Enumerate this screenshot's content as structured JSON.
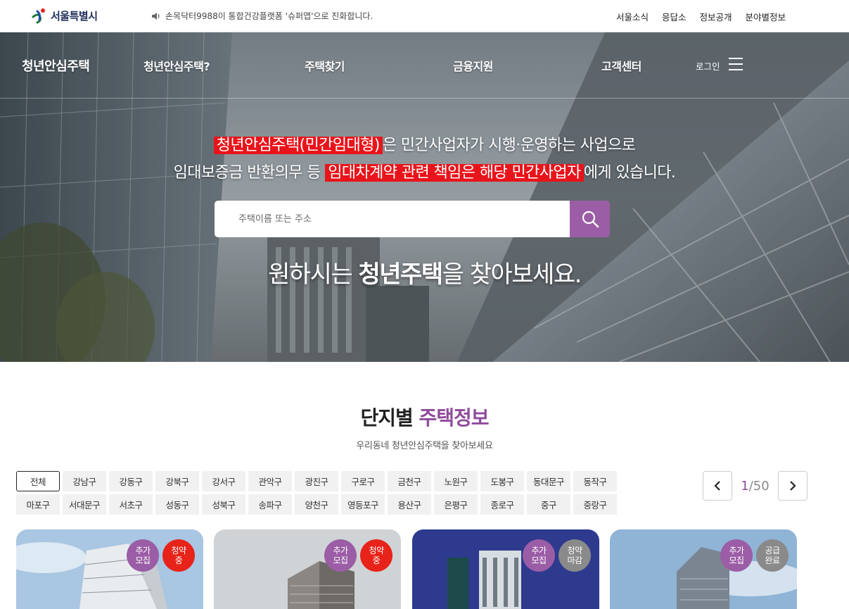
{
  "topbar": {
    "logo_text": "서울특별시",
    "notice": "손목닥터9988이 통합건강플랫폼 '슈퍼앱'으로 진화합니다.",
    "links": [
      "서울소식",
      "응답소",
      "정보공개",
      "분야별정보"
    ]
  },
  "gnb": {
    "brand": "청년안심주택",
    "menu": [
      "청년안심주택?",
      "주택찾기",
      "금융지원",
      "고객센터"
    ],
    "login": "로그인"
  },
  "hero": {
    "line1_highlight": "청년안심주택(민간임대형)",
    "line1_rest": "은 민간사업자가 시행·운영하는 사업으로",
    "line2_pre": "임대보증금 반환의무 등",
    "line2_highlight": "임대차계약 관련 책임은 해당 민간사업자",
    "line2_post": "에게 있습니다.",
    "search_placeholder": "주택이름 또는 주소",
    "slogan_pre": "원하시는",
    "slogan_bold": "청년주택",
    "slogan_post": "을 찾아보세요."
  },
  "section": {
    "title_plain": "단지별",
    "title_accent": "주택정보",
    "subtitle": "우리동네 청년안심주택을 찾아보세요",
    "districts_row1": [
      "전체",
      "강남구",
      "강동구",
      "강북구",
      "강서구",
      "관악구",
      "광진구",
      "구로구",
      "금천구",
      "노원구",
      "도봉구",
      "동대문구",
      "동작구"
    ],
    "districts_row2": [
      "마포구",
      "서대문구",
      "서초구",
      "성동구",
      "성북구",
      "송파구",
      "양천구",
      "영등포구",
      "용산구",
      "은평구",
      "종로구",
      "중구",
      "중랑구"
    ],
    "page_current": "1",
    "page_total": "/50"
  },
  "cards": [
    {
      "badge1": "추가\n모집",
      "badge2": "청약\n중",
      "badge2_color": "#e8231a"
    },
    {
      "badge1": "추가\n모집",
      "badge2": "청약\n중",
      "badge2_color": "#e8231a"
    },
    {
      "badge1": "추가\n모집",
      "badge2": "청약\n마감",
      "badge2_color": "#8a8a8a"
    },
    {
      "badge1": "추가\n모집",
      "badge2": "공급\n완료",
      "badge2_color": "#8a8a8a"
    }
  ],
  "colors": {
    "accent": "#8e4a9b",
    "highlight": "#e8141b"
  }
}
